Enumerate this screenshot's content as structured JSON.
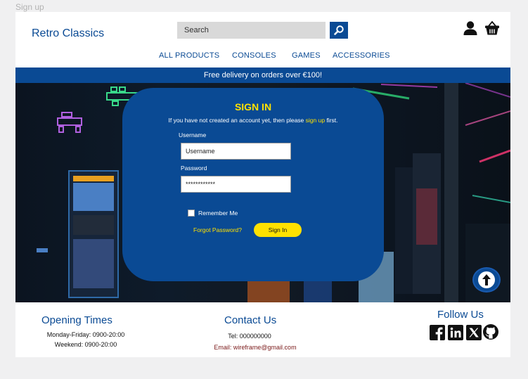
{
  "frame_label": "Sign up",
  "header": {
    "brand": "Retro Classics",
    "search": {
      "placeholder": "Search",
      "value": ""
    },
    "icons": [
      "search-icon",
      "user-icon",
      "basket-icon"
    ]
  },
  "nav": {
    "items": [
      "ALL PRODUCTS",
      "CONSOLES",
      "GAMES",
      "ACCESSORIES"
    ]
  },
  "banner": "Free delivery on orders over €100!",
  "signin": {
    "title": "SIGN IN",
    "subtitle_pre": "If you have not created an account yet, then please ",
    "subtitle_link": "sign up",
    "subtitle_post": " first.",
    "username_label": "Username",
    "username_value": "Username",
    "password_label": "Password",
    "password_value": "************",
    "remember_label": "Remember Me",
    "forgot_link": "Forgot Password?",
    "submit_label": "Sign In"
  },
  "footer": {
    "opening": {
      "title": "Opening Times",
      "lines": [
        "Monday-Friday: 0900-20:00",
        "Weekend: 0900-20:00"
      ]
    },
    "contact": {
      "title": "Contact Us",
      "phone": "Tel: 000000000",
      "email": "Email: wireframe@gmail.com"
    },
    "follow": {
      "title": "Follow Us",
      "icons": [
        "facebook-icon",
        "linkedin-icon",
        "x-icon",
        "github-icon"
      ]
    }
  },
  "colors": {
    "brand_blue": "#0a4a94",
    "accent_yellow": "#ffe100",
    "page_bg": "#f0f0f1"
  }
}
